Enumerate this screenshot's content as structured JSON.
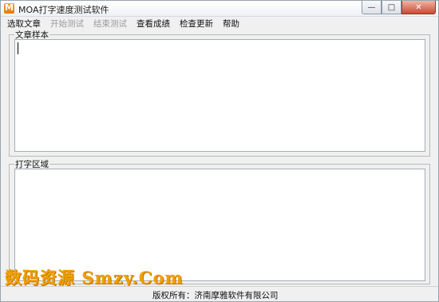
{
  "window": {
    "title": "MOA打字速度测试软件",
    "controls": {
      "minimize": "—",
      "maximize": "□",
      "close": "✕"
    }
  },
  "menu": {
    "items": [
      {
        "label": "选取文章",
        "enabled": true
      },
      {
        "label": "开始测试",
        "enabled": false
      },
      {
        "label": "结束测试",
        "enabled": false
      },
      {
        "label": "查看成绩",
        "enabled": true
      },
      {
        "label": "检查更新",
        "enabled": true
      },
      {
        "label": "帮助",
        "enabled": true
      }
    ]
  },
  "sample_panel": {
    "legend": "文章样本",
    "text": ""
  },
  "typing_panel": {
    "legend": "打字区域",
    "text": ""
  },
  "status_bar": {
    "text": "版权所有：济南摩雅软件有限公司"
  },
  "watermark": {
    "text": "数码资源 Smzy.Com"
  },
  "colors": {
    "watermark": "#f0a000",
    "close_button": "#c94a33",
    "background": "#f0f0f0"
  },
  "icons": {
    "app": "moa-logo-icon"
  }
}
